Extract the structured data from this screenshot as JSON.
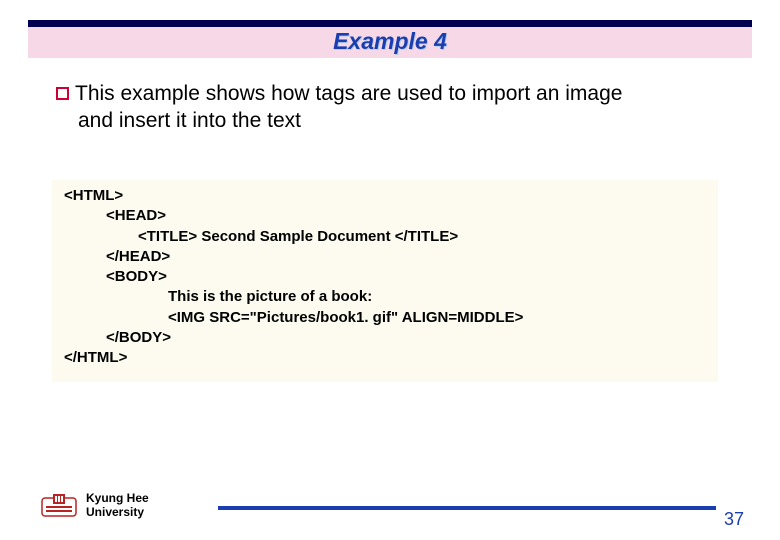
{
  "title": "Example 4",
  "bullet": {
    "text_line1": "This example shows how tags are used to import an image",
    "text_line2": "and insert it into the text"
  },
  "code": {
    "l0": "<HTML>",
    "l1": "<HEAD>",
    "l2_open": "<TITLE>",
    "l2_mid": " Second Sample Document ",
    "l2_close": "</TITLE>",
    "l3": "</HEAD>",
    "l4": "<BODY>",
    "l5": "This is the picture of a book:",
    "l6": "<IMG SRC=\"Pictures/book1. gif\"   ALIGN=MIDDLE>",
    "l7": "</BODY>",
    "l8": "</HTML>"
  },
  "footer": {
    "university_line1": "Kyung Hee",
    "university_line2": "University",
    "page_number": "37"
  }
}
